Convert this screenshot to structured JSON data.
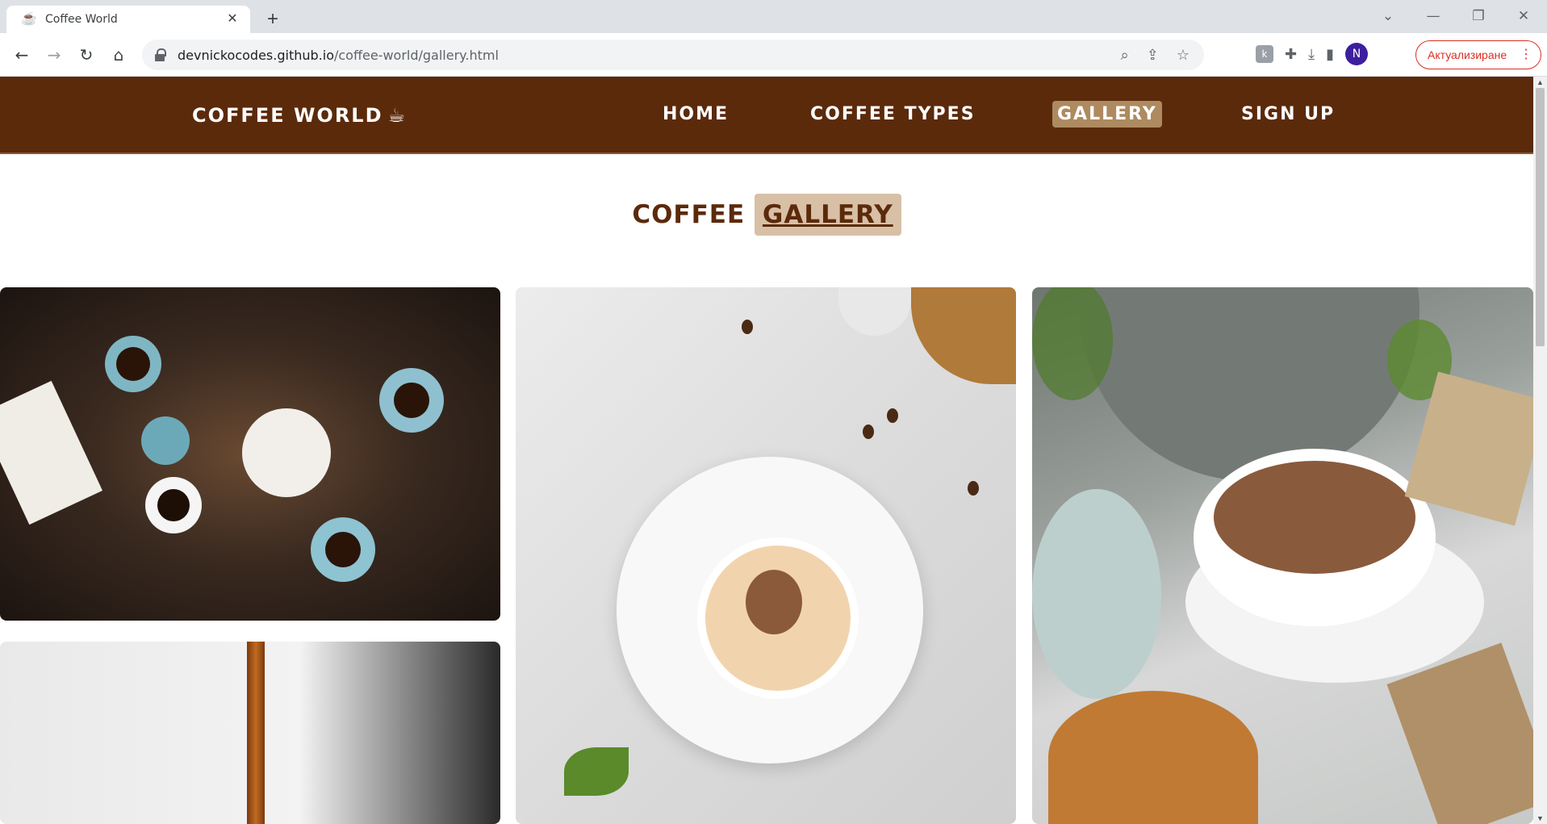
{
  "browser": {
    "tab_title": "Coffee World",
    "tab_favicon": "coffee-cup-icon",
    "new_tab_label": "+",
    "url_host": "devnickocodes.github.io",
    "url_path": "/coffee-world/gallery.html",
    "profile_initial": "N",
    "update_label": "Актуализиране"
  },
  "site": {
    "brand": "COFFEE WORLD",
    "brand_icon": "mug-hot-icon",
    "nav": [
      {
        "label": "HOME"
      },
      {
        "label": "COFFEE TYPES"
      },
      {
        "label": "GALLERY"
      },
      {
        "label": "SIGN UP"
      }
    ],
    "active_nav": "GALLERY"
  },
  "gallery": {
    "title_prefix": "COFFEE",
    "title_highlight": "GALLERY",
    "images": [
      {
        "name": "coffee-table-gathering-photo"
      },
      {
        "name": "latte-heart-photo"
      },
      {
        "name": "cappuccino-croissant-photo"
      },
      {
        "name": "coffee-pour-photo"
      }
    ]
  },
  "colors": {
    "nav_bg": "#5b2a0b",
    "nav_active_bg": "#ae8a60",
    "title_color": "#5b2a0b",
    "title_highlight_bg": "#d8c0a6"
  }
}
